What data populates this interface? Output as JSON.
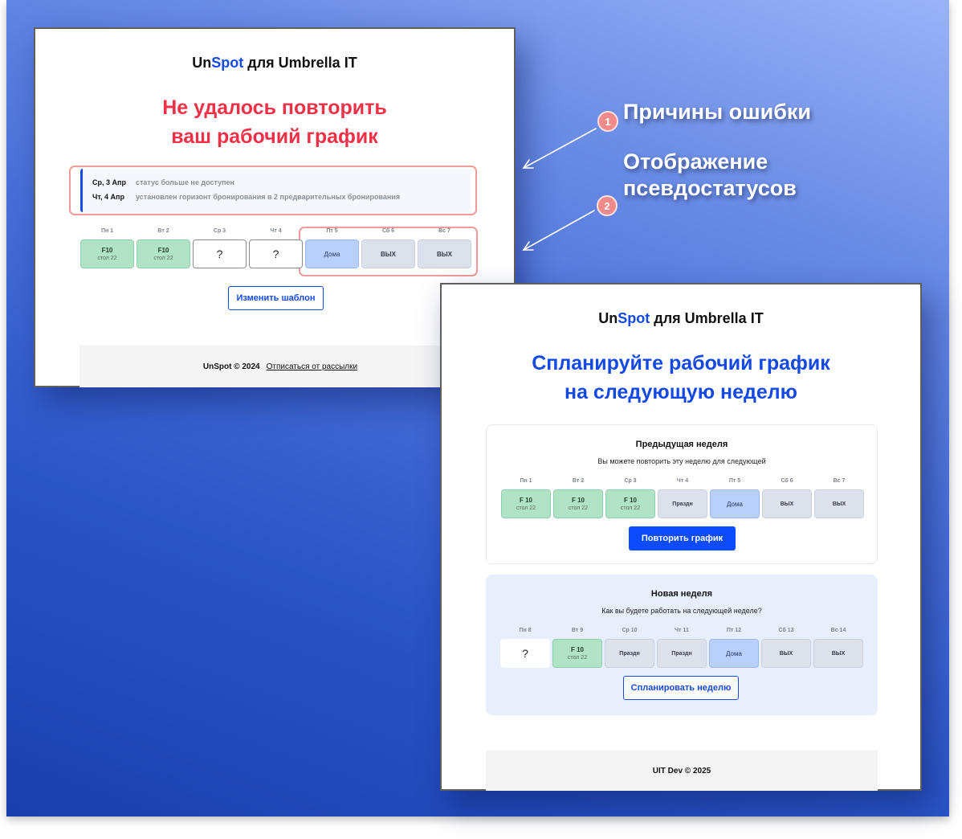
{
  "annotations": {
    "item1": {
      "number": "1",
      "text": "Причины ошибки"
    },
    "item2": {
      "number": "2",
      "line1": "Отображение",
      "line2": "псевдостатусов"
    }
  },
  "card1": {
    "brand": {
      "un": "Un",
      "spot": "Spot",
      "rest": " для Umbrella IT"
    },
    "title_line1": "Не удалось повторить",
    "title_line2": "ваш рабочий график",
    "reasons": [
      {
        "date": "Ср, 3 Апр",
        "text": "статус больше не доступен"
      },
      {
        "date": "Чт, 4 Апр",
        "text": "установлен горизонт бронирования в 2 предварительных бронирования"
      }
    ],
    "week": [
      {
        "label": "Пн 1",
        "kind": "green",
        "main": "F10",
        "sub": "стол 22"
      },
      {
        "label": "Вт 2",
        "kind": "green",
        "main": "F10",
        "sub": "стол 22"
      },
      {
        "label": "Ср 3",
        "kind": "q",
        "main": "?",
        "sub": ""
      },
      {
        "label": "Чт 4",
        "kind": "q",
        "main": "?",
        "sub": ""
      },
      {
        "label": "Пт 5",
        "kind": "blue",
        "main": "Дома",
        "sub": ""
      },
      {
        "label": "Сб 6",
        "kind": "gray",
        "main": "ВЫХ",
        "sub": ""
      },
      {
        "label": "Вс 7",
        "kind": "gray",
        "main": "ВЫХ",
        "sub": ""
      }
    ],
    "button": "Изменить шаблон",
    "footer": {
      "copyright": "UnSpot © 2024",
      "link": "Отписаться от рассылки"
    }
  },
  "card2": {
    "brand": {
      "un": "Un",
      "spot": "Spot",
      "rest": " для Umbrella IT"
    },
    "title_line1": "Спланируйте рабочий график",
    "title_line2": "на следующую неделю",
    "prev": {
      "title": "Предыдущая неделя",
      "subtitle": "Вы можете повторить эту неделю для следующей",
      "week": [
        {
          "label": "Пн 1",
          "kind": "green",
          "main": "F 10",
          "sub": "стол 22"
        },
        {
          "label": "Вт 2",
          "kind": "green",
          "main": "F 10",
          "sub": "стол 22"
        },
        {
          "label": "Ср 3",
          "kind": "green",
          "main": "F 10",
          "sub": "стол 22"
        },
        {
          "label": "Чт 4",
          "kind": "gray",
          "main": "Праздн",
          "sub": ""
        },
        {
          "label": "Пт 5",
          "kind": "blue",
          "main": "Дома",
          "sub": ""
        },
        {
          "label": "Сб 6",
          "kind": "gray",
          "main": "ВЫХ",
          "sub": ""
        },
        {
          "label": "Вс 7",
          "kind": "gray",
          "main": "ВЫХ",
          "sub": ""
        }
      ],
      "button": "Повторить график"
    },
    "next": {
      "title": "Новая неделя",
      "subtitle": "Как вы будете работать на следующей неделе?",
      "week": [
        {
          "label": "Пн 8",
          "kind": "qn",
          "main": "?",
          "sub": ""
        },
        {
          "label": "Вт 9",
          "kind": "green",
          "main": "F 10",
          "sub": "стол 22"
        },
        {
          "label": "Ср 10",
          "kind": "gray",
          "main": "Праздн",
          "sub": ""
        },
        {
          "label": "Чт 11",
          "kind": "gray",
          "main": "Праздн",
          "sub": ""
        },
        {
          "label": "Пт 12",
          "kind": "blue",
          "main": "Дома",
          "sub": ""
        },
        {
          "label": "Сб 13",
          "kind": "gray",
          "main": "ВЫХ",
          "sub": ""
        },
        {
          "label": "Вс 14",
          "kind": "gray",
          "main": "ВЫХ",
          "sub": ""
        }
      ],
      "button": "Спланировать неделю"
    },
    "footer": {
      "copyright": "UIT Dev © 2025"
    }
  },
  "colors": {
    "accent_blue": "#1549e6",
    "error_red": "#ef3148",
    "highlight_pink": "#f29a9a",
    "office_green": "#b1e3c7",
    "home_blue": "#b9cffc",
    "off_gray": "#dde1ec"
  }
}
